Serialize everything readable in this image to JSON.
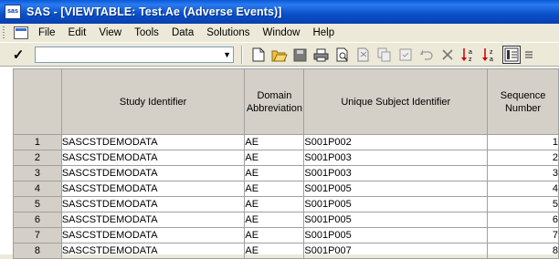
{
  "window": {
    "title": "SAS - [VIEWTABLE: Test.Ae (Adverse Events)]",
    "logo_text": "sas"
  },
  "menu": {
    "items": [
      "File",
      "Edit",
      "View",
      "Tools",
      "Data",
      "Solutions",
      "Window",
      "Help"
    ]
  },
  "toolbar": {
    "command_value": ""
  },
  "table": {
    "columns": [
      "Study Identifier",
      "Domain\nAbbreviation",
      "Unique Subject Identifier",
      "Sequence\nNumber"
    ],
    "rows": [
      {
        "n": "1",
        "study": "SASCSTDEMODATA",
        "domain": "AE",
        "subject": "S001P002",
        "seq": "1"
      },
      {
        "n": "2",
        "study": "SASCSTDEMODATA",
        "domain": "AE",
        "subject": "S001P003",
        "seq": "2"
      },
      {
        "n": "3",
        "study": "SASCSTDEMODATA",
        "domain": "AE",
        "subject": "S001P003",
        "seq": "3"
      },
      {
        "n": "4",
        "study": "SASCSTDEMODATA",
        "domain": "AE",
        "subject": "S001P005",
        "seq": "4"
      },
      {
        "n": "5",
        "study": "SASCSTDEMODATA",
        "domain": "AE",
        "subject": "S001P005",
        "seq": "5"
      },
      {
        "n": "6",
        "study": "SASCSTDEMODATA",
        "domain": "AE",
        "subject": "S001P005",
        "seq": "6"
      },
      {
        "n": "7",
        "study": "SASCSTDEMODATA",
        "domain": "AE",
        "subject": "S001P005",
        "seq": "7"
      },
      {
        "n": "8",
        "study": "SASCSTDEMODATA",
        "domain": "AE",
        "subject": "S001P007",
        "seq": "8"
      }
    ]
  }
}
